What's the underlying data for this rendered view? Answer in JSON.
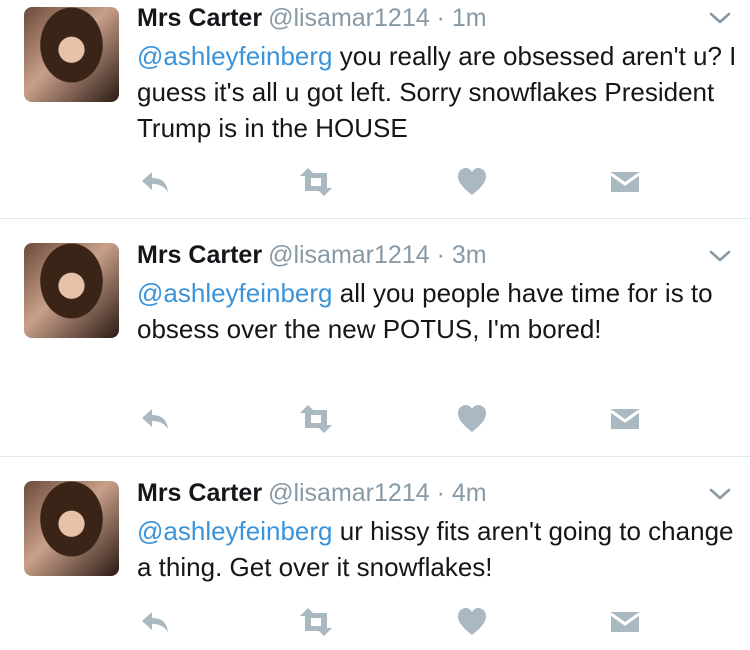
{
  "tweets": [
    {
      "name": "Mrs Carter",
      "handle": "@lisamar1214",
      "dot": "·",
      "time": "1m",
      "mention": "@ashleyfeinberg",
      "text": " you really are obsessed aren't u? I guess it's all u got left.  Sorry snowflakes President Trump is in the HOUSE"
    },
    {
      "name": "Mrs Carter",
      "handle": "@lisamar1214",
      "dot": "·",
      "time": "3m",
      "mention": "@ashleyfeinberg",
      "text": " all you people have time for is to obsess over the new POTUS, I'm bored!"
    },
    {
      "name": "Mrs Carter",
      "handle": "@lisamar1214",
      "dot": "·",
      "time": "4m",
      "mention": "@ashleyfeinberg",
      "text": " ur hissy fits aren't going to change a thing. Get over it snowflakes!"
    }
  ],
  "icons": {
    "reply": "reply-icon",
    "retweet": "retweet-icon",
    "like": "heart-icon",
    "dm": "envelope-icon",
    "menu": "chevron-down-icon"
  },
  "colors": {
    "mention": "#3b94d9",
    "muted": "#8899a6",
    "icon": "#aab8c2",
    "divider": "#e1e8ed"
  }
}
